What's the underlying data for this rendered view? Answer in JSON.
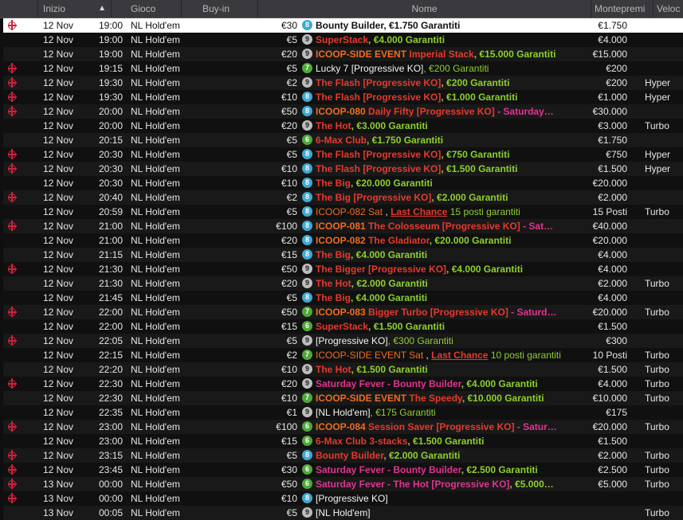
{
  "header": {
    "col_start": "Inizio",
    "col_game": "Gioco",
    "col_buyin": "Buy-in",
    "col_name": "Nome",
    "col_prize": "Montepremi",
    "col_speed": "Veloc"
  },
  "rows": [
    {
      "icon": true,
      "date": "12 Nov",
      "time": "19:00",
      "game": "NL Hold'em",
      "buyin": "€30",
      "badge": "8",
      "name": [
        [
          "k",
          "Bounty Builder"
        ],
        [
          "k",
          ", €1.750 Garantiti"
        ]
      ],
      "prize": "€1.750",
      "speed": "",
      "selected": true
    },
    {
      "icon": false,
      "date": "12 Nov",
      "time": "19:00",
      "game": "NL Hold'em",
      "buyin": "€5",
      "badge": "9",
      "name": [
        [
          "r",
          "SuperStack"
        ],
        [
          "g",
          ", €4.000 Garantiti"
        ]
      ],
      "prize": "€4.000",
      "speed": ""
    },
    {
      "icon": false,
      "date": "12 Nov",
      "time": "19:00",
      "game": "NL Hold'em",
      "buyin": "€20",
      "badge": "9",
      "name": [
        [
          "o",
          "ICOOP-SIDE EVENT "
        ],
        [
          "r",
          "Imperial Stack"
        ],
        [
          "g",
          ", €15.000 Garantiti"
        ]
      ],
      "prize": "€15.000",
      "speed": ""
    },
    {
      "icon": true,
      "date": "12 Nov",
      "time": "19:15",
      "game": "NL Hold'em",
      "buyin": "€5",
      "badge": "7",
      "name": [
        [
          "wn",
          "Lucky 7 [Progressive KO]"
        ],
        [
          "gn",
          ", €200 Garantiti"
        ]
      ],
      "prize": "€200",
      "speed": ""
    },
    {
      "icon": true,
      "date": "12 Nov",
      "time": "19:30",
      "game": "NL Hold'em",
      "buyin": "€2",
      "badge": "9",
      "name": [
        [
          "r",
          "The Flash [Progressive KO]"
        ],
        [
          "g",
          ", €200 Garantiti"
        ]
      ],
      "prize": "€200",
      "speed": "Hyper"
    },
    {
      "icon": true,
      "date": "12 Nov",
      "time": "19:30",
      "game": "NL Hold'em",
      "buyin": "€10",
      "badge": "8",
      "name": [
        [
          "r",
          "The Flash [Progressive KO]"
        ],
        [
          "g",
          ", €1.000 Garantiti"
        ]
      ],
      "prize": "€1.000",
      "speed": "Hyper"
    },
    {
      "icon": true,
      "date": "12 Nov",
      "time": "20:00",
      "game": "NL Hold'em",
      "buyin": "€50",
      "badge": "8",
      "name": [
        [
          "o",
          "ICOOP-080 "
        ],
        [
          "r",
          "Daily Fifty [Progressive KO]"
        ],
        [
          "p",
          " - Saturday…"
        ]
      ],
      "prize": "€30.000",
      "speed": ""
    },
    {
      "icon": false,
      "date": "12 Nov",
      "time": "20:00",
      "game": "NL Hold'em",
      "buyin": "€20",
      "badge": "9",
      "name": [
        [
          "r",
          "The Hot"
        ],
        [
          "g",
          ", €3.000 Garantiti"
        ]
      ],
      "prize": "€3.000",
      "speed": "Turbo"
    },
    {
      "icon": false,
      "date": "12 Nov",
      "time": "20:15",
      "game": "NL Hold'em",
      "buyin": "€5",
      "badge": "6",
      "name": [
        [
          "r",
          "6-Max Club"
        ],
        [
          "g",
          ", €1.750 Garantiti"
        ]
      ],
      "prize": "€1.750",
      "speed": ""
    },
    {
      "icon": true,
      "date": "12 Nov",
      "time": "20:30",
      "game": "NL Hold'em",
      "buyin": "€5",
      "badge": "8",
      "name": [
        [
          "r",
          "The Flash [Progressive KO]"
        ],
        [
          "g",
          ", €750 Garantiti"
        ]
      ],
      "prize": "€750",
      "speed": "Hyper"
    },
    {
      "icon": true,
      "date": "12 Nov",
      "time": "20:30",
      "game": "NL Hold'em",
      "buyin": "€10",
      "badge": "8",
      "name": [
        [
          "r",
          "The Flash [Progressive KO]"
        ],
        [
          "g",
          ", €1.500 Garantiti"
        ]
      ],
      "prize": "€1.500",
      "speed": "Hyper"
    },
    {
      "icon": false,
      "date": "12 Nov",
      "time": "20:30",
      "game": "NL Hold'em",
      "buyin": "€10",
      "badge": "8",
      "name": [
        [
          "r",
          "The Big"
        ],
        [
          "g",
          ", €20.000 Garantiti"
        ]
      ],
      "prize": "€20.000",
      "speed": ""
    },
    {
      "icon": true,
      "date": "12 Nov",
      "time": "20:40",
      "game": "NL Hold'em",
      "buyin": "€2",
      "badge": "8",
      "name": [
        [
          "r",
          "The Big [Progressive KO]"
        ],
        [
          "g",
          ", €2.000 Garantiti"
        ]
      ],
      "prize": "€2.000",
      "speed": ""
    },
    {
      "icon": false,
      "date": "12 Nov",
      "time": "20:59",
      "game": "NL Hold'em",
      "buyin": "€5",
      "badge": "8",
      "name": [
        [
          "on",
          "ICOOP-082 Sat"
        ],
        [
          "wn",
          " , "
        ],
        [
          "u",
          "Last Chance"
        ],
        [
          "gn",
          " 15 posti garantiti"
        ]
      ],
      "prize": "15 Posti",
      "speed": "Turbo"
    },
    {
      "icon": true,
      "date": "12 Nov",
      "time": "21:00",
      "game": "NL Hold'em",
      "buyin": "€100",
      "badge": "8",
      "name": [
        [
          "o",
          "ICOOP-081 "
        ],
        [
          "r",
          "The Colosseum [Progressive KO]"
        ],
        [
          "p",
          " - Sat…"
        ]
      ],
      "prize": "€40.000",
      "speed": ""
    },
    {
      "icon": false,
      "date": "12 Nov",
      "time": "21:00",
      "game": "NL Hold'em",
      "buyin": "€20",
      "badge": "8",
      "name": [
        [
          "o",
          "ICOOP-082 "
        ],
        [
          "r",
          "The Gladiator"
        ],
        [
          "g",
          ", €20.000 Garantiti"
        ]
      ],
      "prize": "€20.000",
      "speed": ""
    },
    {
      "icon": false,
      "date": "12 Nov",
      "time": "21:15",
      "game": "NL Hold'em",
      "buyin": "€15",
      "badge": "8",
      "name": [
        [
          "r",
          "The Big"
        ],
        [
          "g",
          ", €4.000 Garantiti"
        ]
      ],
      "prize": "€4.000",
      "speed": ""
    },
    {
      "icon": true,
      "date": "12 Nov",
      "time": "21:30",
      "game": "NL Hold'em",
      "buyin": "€50",
      "badge": "9",
      "name": [
        [
          "r",
          "The Bigger [Progressive KO]"
        ],
        [
          "g",
          ", €4.000 Garantiti"
        ]
      ],
      "prize": "€4.000",
      "speed": ""
    },
    {
      "icon": false,
      "date": "12 Nov",
      "time": "21:30",
      "game": "NL Hold'em",
      "buyin": "€20",
      "badge": "9",
      "name": [
        [
          "r",
          "The Hot"
        ],
        [
          "g",
          ", €2.000 Garantiti"
        ]
      ],
      "prize": "€2.000",
      "speed": "Turbo"
    },
    {
      "icon": false,
      "date": "12 Nov",
      "time": "21:45",
      "game": "NL Hold'em",
      "buyin": "€5",
      "badge": "8",
      "name": [
        [
          "r",
          "The Big"
        ],
        [
          "g",
          ", €4.000 Garantiti"
        ]
      ],
      "prize": "€4.000",
      "speed": ""
    },
    {
      "icon": true,
      "date": "12 Nov",
      "time": "22:00",
      "game": "NL Hold'em",
      "buyin": "€50",
      "badge": "7",
      "name": [
        [
          "o",
          "ICOOP-083 "
        ],
        [
          "r",
          "Bigger Turbo [Progressive KO]"
        ],
        [
          "p",
          " - Saturd…"
        ]
      ],
      "prize": "€20.000",
      "speed": "Turbo"
    },
    {
      "icon": false,
      "date": "12 Nov",
      "time": "22:00",
      "game": "NL Hold'em",
      "buyin": "€15",
      "badge": "6",
      "name": [
        [
          "r",
          "SuperStack"
        ],
        [
          "g",
          ", €1.500 Garantiti"
        ]
      ],
      "prize": "€1.500",
      "speed": ""
    },
    {
      "icon": true,
      "date": "12 Nov",
      "time": "22:05",
      "game": "NL Hold'em",
      "buyin": "€5",
      "badge": "9",
      "name": [
        [
          "wn",
          "[Progressive KO]"
        ],
        [
          "gn",
          ", €300 Garantiti"
        ]
      ],
      "prize": "€300",
      "speed": ""
    },
    {
      "icon": false,
      "date": "12 Nov",
      "time": "22:15",
      "game": "NL Hold'em",
      "buyin": "€2",
      "badge": "7",
      "name": [
        [
          "on",
          "ICOOP-SIDE EVENT Sat"
        ],
        [
          "wn",
          " , "
        ],
        [
          "u",
          "Last Chance"
        ],
        [
          "gn",
          " 10 posti garantiti"
        ]
      ],
      "prize": "10 Posti",
      "speed": "Turbo"
    },
    {
      "icon": false,
      "date": "12 Nov",
      "time": "22:20",
      "game": "NL Hold'em",
      "buyin": "€10",
      "badge": "9",
      "name": [
        [
          "r",
          "The Hot"
        ],
        [
          "g",
          ", €1.500 Garantiti"
        ]
      ],
      "prize": "€1.500",
      "speed": "Turbo"
    },
    {
      "icon": true,
      "date": "12 Nov",
      "time": "22:30",
      "game": "NL Hold'em",
      "buyin": "€20",
      "badge": "9",
      "name": [
        [
          "p",
          "Saturday Fever - Bounty Builder"
        ],
        [
          "g",
          ", €4.000 Garantiti"
        ]
      ],
      "prize": "€4.000",
      "speed": "Turbo"
    },
    {
      "icon": false,
      "date": "12 Nov",
      "time": "22:30",
      "game": "NL Hold'em",
      "buyin": "€10",
      "badge": "7",
      "name": [
        [
          "o",
          "ICOOP-SIDE EVENT "
        ],
        [
          "r",
          "The Speedy"
        ],
        [
          "g",
          ", €10.000 Garantiti"
        ]
      ],
      "prize": "€10.000",
      "speed": "Turbo"
    },
    {
      "icon": false,
      "date": "12 Nov",
      "time": "22:35",
      "game": "NL Hold'em",
      "buyin": "€1",
      "badge": "9",
      "name": [
        [
          "wn",
          "[NL Hold'em]"
        ],
        [
          "gn",
          ", €175 Garantiti"
        ]
      ],
      "prize": "€175",
      "speed": ""
    },
    {
      "icon": true,
      "date": "12 Nov",
      "time": "23:00",
      "game": "NL Hold'em",
      "buyin": "€100",
      "badge": "6",
      "name": [
        [
          "o",
          "ICOOP-084 "
        ],
        [
          "r",
          "Session Saver [Progressive KO]"
        ],
        [
          "p",
          " - Satur…"
        ]
      ],
      "prize": "€20.000",
      "speed": "Turbo"
    },
    {
      "icon": false,
      "date": "12 Nov",
      "time": "23:00",
      "game": "NL Hold'em",
      "buyin": "€15",
      "badge": "6",
      "name": [
        [
          "r",
          "6-Max Club 3-stacks"
        ],
        [
          "g",
          ", €1.500 Garantiti"
        ]
      ],
      "prize": "€1.500",
      "speed": ""
    },
    {
      "icon": true,
      "date": "12 Nov",
      "time": "23:15",
      "game": "NL Hold'em",
      "buyin": "€5",
      "badge": "8",
      "name": [
        [
          "r",
          "Bounty Builder"
        ],
        [
          "g",
          ", €2.000 Garantiti"
        ]
      ],
      "prize": "€2.000",
      "speed": "Turbo"
    },
    {
      "icon": true,
      "date": "12 Nov",
      "time": "23:45",
      "game": "NL Hold'em",
      "buyin": "€30",
      "badge": "6",
      "name": [
        [
          "p",
          "Saturday Fever - Bounty Builder"
        ],
        [
          "g",
          ", €2.500 Garantiti"
        ]
      ],
      "prize": "€2.500",
      "speed": "Turbo"
    },
    {
      "icon": true,
      "date": "13 Nov",
      "time": "00:00",
      "game": "NL Hold'em",
      "buyin": "€50",
      "badge": "6",
      "name": [
        [
          "p",
          "Saturday Fever - The Hot [Progressive KO]"
        ],
        [
          "g",
          ", €5.000…"
        ]
      ],
      "prize": "€5.000",
      "speed": "Turbo"
    },
    {
      "icon": true,
      "date": "13 Nov",
      "time": "00:00",
      "game": "NL Hold'em",
      "buyin": "€10",
      "badge": "8",
      "name": [
        [
          "wn",
          "[Progressive KO]"
        ]
      ],
      "prize": "",
      "speed": ""
    },
    {
      "icon": false,
      "date": "13 Nov",
      "time": "00:05",
      "game": "NL Hold'em",
      "buyin": "€5",
      "badge": "9",
      "name": [
        [
          "wn",
          "[NL Hold'em]"
        ]
      ],
      "prize": "",
      "speed": "Turbo"
    }
  ]
}
